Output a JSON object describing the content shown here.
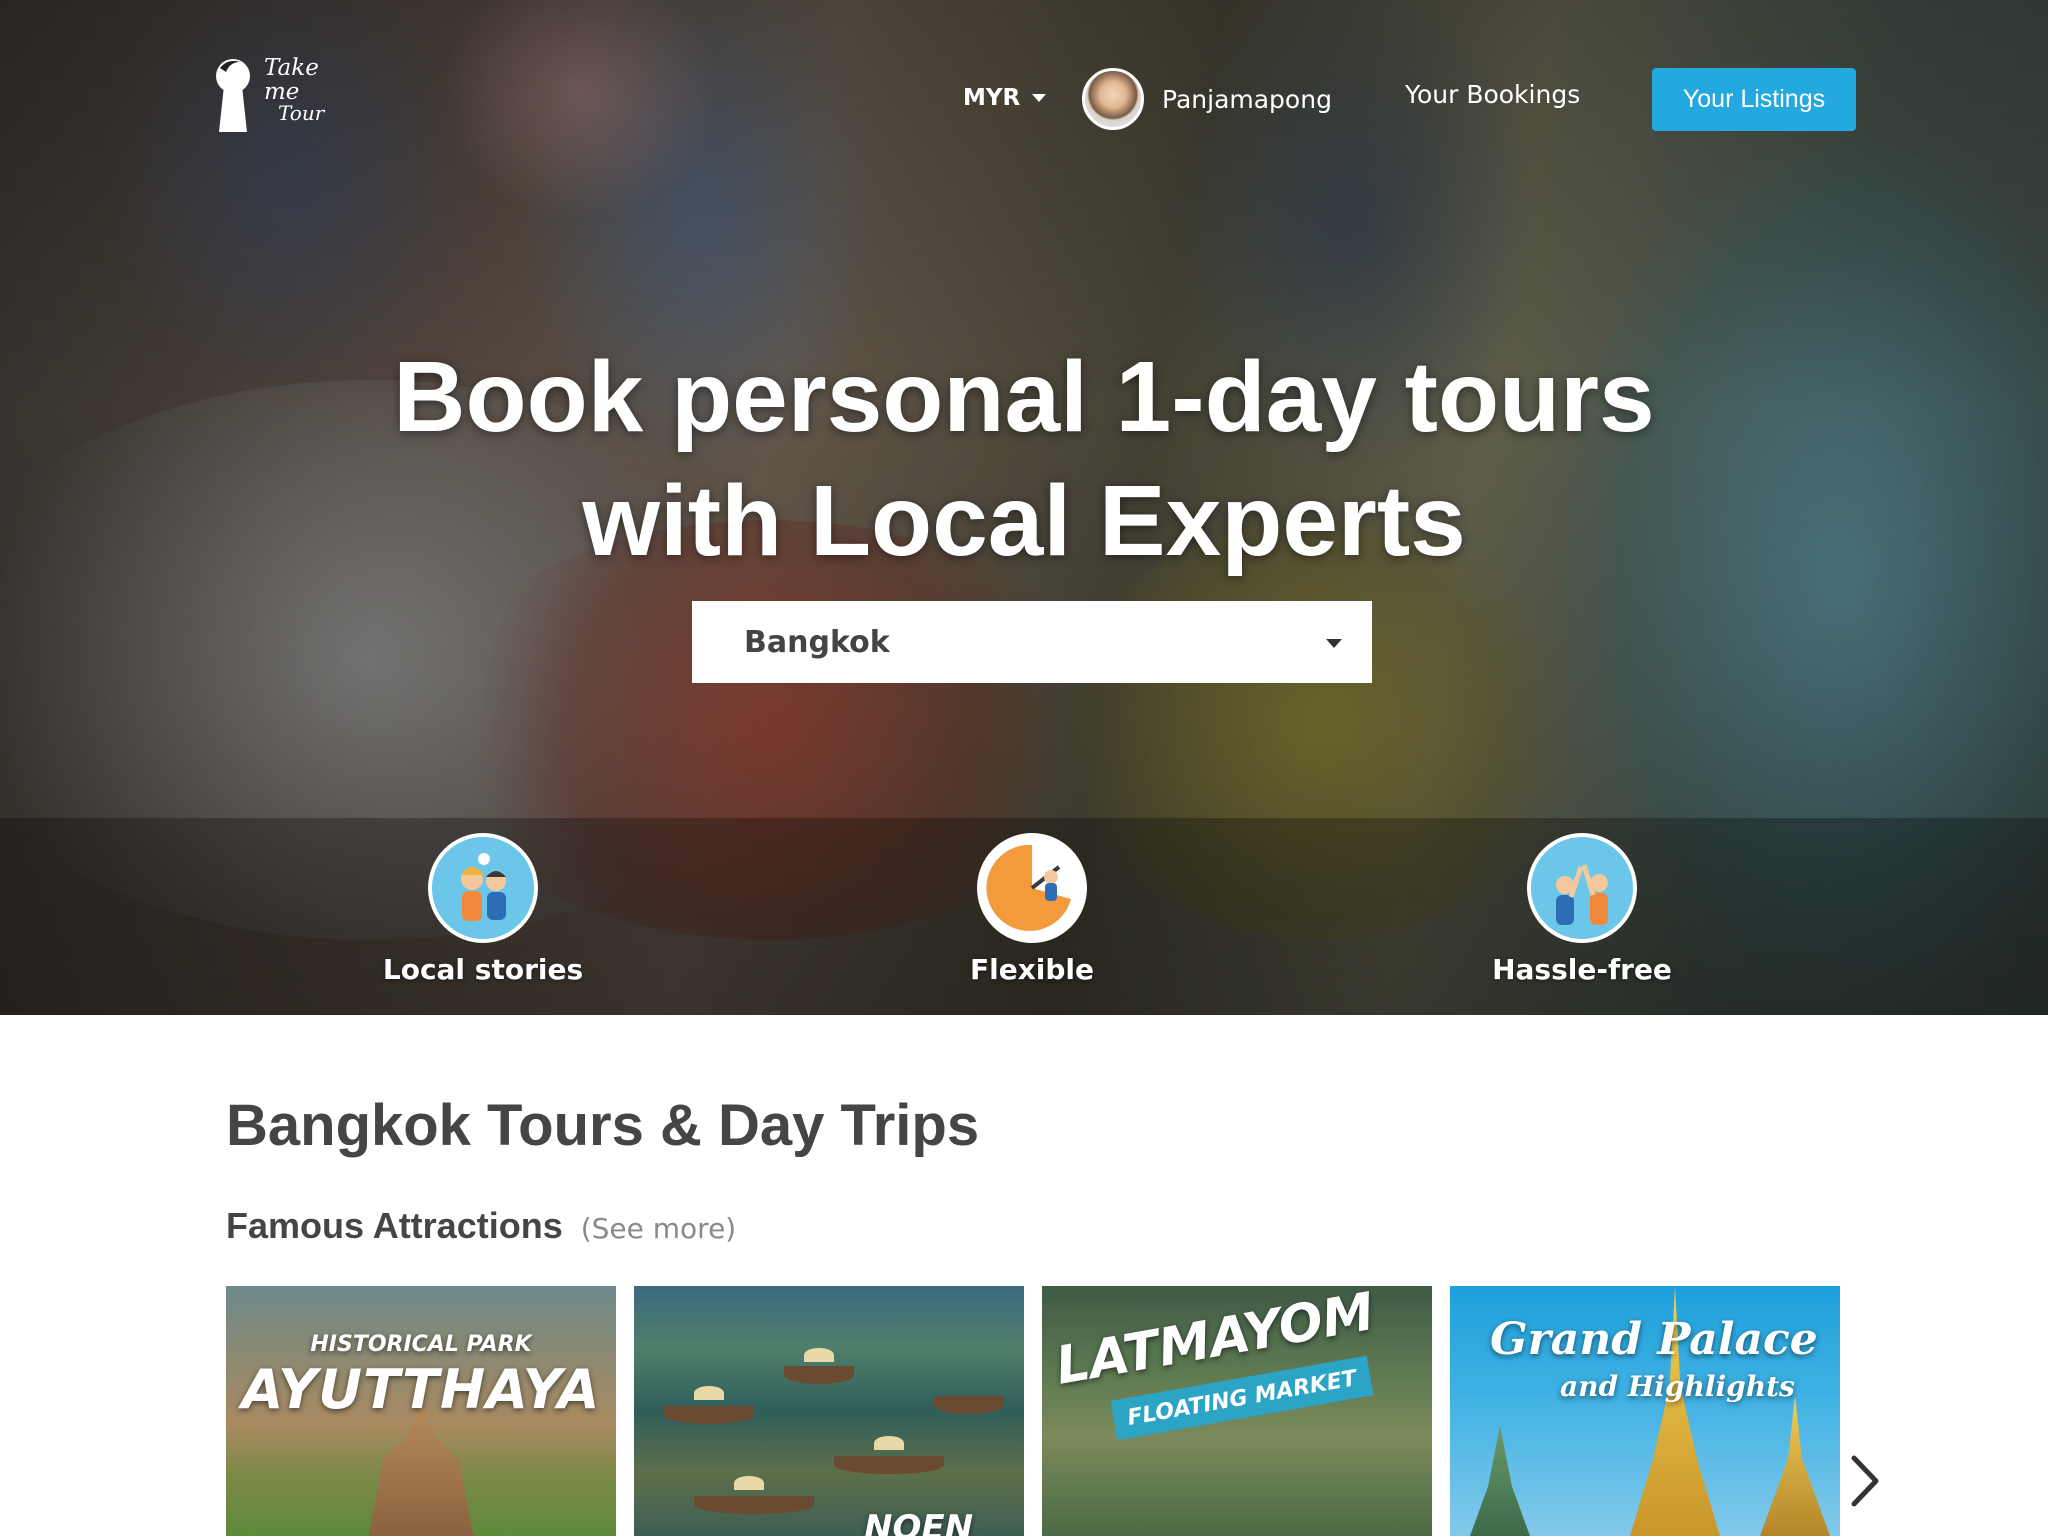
{
  "nav": {
    "logo_text_line1": "Take me",
    "logo_text_line2": "Tour",
    "currency": "MYR",
    "user_name": "Panjamapong",
    "bookings_label": "Your Bookings",
    "listings_label": "Your Listings"
  },
  "hero": {
    "headline_line1": "Book personal 1-day tours",
    "headline_line2": "with Local Experts",
    "city_selected": "Bangkok",
    "features": [
      {
        "label": "Local stories",
        "icon": "local-stories-icon"
      },
      {
        "label": "Flexible",
        "icon": "clock-icon"
      },
      {
        "label": "Hassle-free",
        "icon": "high-five-icon"
      }
    ]
  },
  "content": {
    "section_title": "Bangkok Tours & Day Trips",
    "subsection_title": "Famous Attractions",
    "see_more": "(See more)",
    "cards": [
      {
        "caption_top": "HISTORICAL PARK",
        "caption": "AYUTTHAYA"
      },
      {
        "caption": "NOEN"
      },
      {
        "caption": "LATMAYOM",
        "ribbon": "FLOATING MARKET"
      },
      {
        "caption_top": "Grand Palace",
        "caption": "and Highlights"
      }
    ]
  },
  "colors": {
    "accent": "#23a8e0",
    "heading_text": "#454545",
    "muted_text": "#8a8a8a"
  }
}
